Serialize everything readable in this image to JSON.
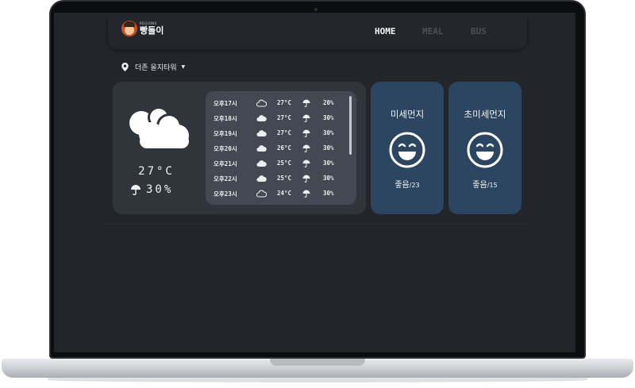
{
  "app": {
    "logo_sub": "REGIONS",
    "logo_main": "빵돌이"
  },
  "nav": {
    "home": "HOME",
    "meal": "MEAL",
    "bus": "BUS"
  },
  "location": {
    "name": "더존 을지타워"
  },
  "current": {
    "temp": "27°C",
    "rain": "30%",
    "icon": "cloud-icon"
  },
  "hourly": [
    {
      "time": "오후17시",
      "icon": "cloud-outline-icon",
      "temp": "27°C",
      "pop": "20%"
    },
    {
      "time": "오후18시",
      "icon": "cloud-icon",
      "temp": "27°C",
      "pop": "30%"
    },
    {
      "time": "오후19시",
      "icon": "cloud-icon",
      "temp": "27°C",
      "pop": "30%"
    },
    {
      "time": "오후20시",
      "icon": "cloud-icon",
      "temp": "26°C",
      "pop": "30%"
    },
    {
      "time": "오후21시",
      "icon": "cloud-icon",
      "temp": "25°C",
      "pop": "30%"
    },
    {
      "time": "오후22시",
      "icon": "cloud-icon",
      "temp": "25°C",
      "pop": "30%"
    },
    {
      "time": "오후23시",
      "icon": "cloud-outline-icon",
      "temp": "24°C",
      "pop": "30%"
    }
  ],
  "dust": {
    "pm10": {
      "title": "미세먼지",
      "status": "좋음",
      "value": "/23",
      "icon": "smile-icon"
    },
    "pm25": {
      "title": "초미세먼지",
      "status": "좋음",
      "value": "/15",
      "icon": "smile-icon"
    }
  },
  "colors": {
    "screen_bg": "#22262b",
    "card_bg": "#30353c",
    "hourly_bg": "#434952",
    "dust_bg": "#2c4560",
    "nav_inactive": "#4a4f57"
  }
}
